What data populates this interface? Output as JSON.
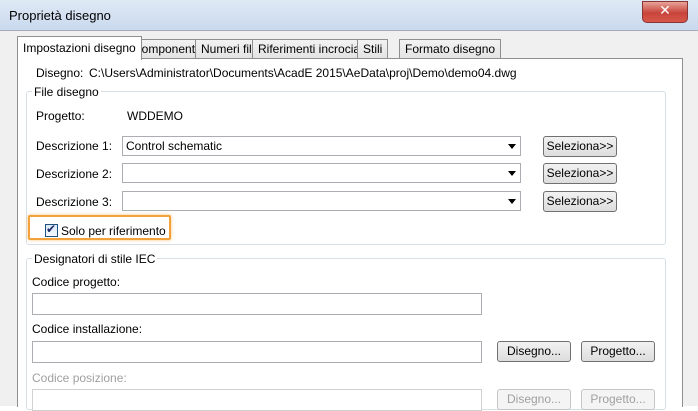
{
  "window": {
    "title": "Proprietà disegno",
    "close_glyph": "✕"
  },
  "tabs": [
    {
      "label": "Impostazioni disegno",
      "active": true
    },
    {
      "label": "Componenti"
    },
    {
      "label": "Numeri fili"
    },
    {
      "label": "Riferimenti incrociati"
    },
    {
      "label": "Stili"
    },
    {
      "label": "Formato disegno"
    }
  ],
  "drawing": {
    "label": "Disegno:",
    "path": "C:\\Users\\Administrator\\Documents\\AcadE 2015\\AeData\\proj\\Demo\\demo04.dwg"
  },
  "file_group": {
    "title": "File disegno",
    "project_label": "Progetto:",
    "project_value": "WDDEMO",
    "descriptions": [
      {
        "label": "Descrizione 1:",
        "value": "Control schematic",
        "button": "Seleziona>>"
      },
      {
        "label": "Descrizione 2:",
        "value": "",
        "button": "Seleziona>>"
      },
      {
        "label": "Descrizione 3:",
        "value": "",
        "button": "Seleziona>>"
      }
    ],
    "reference_only": {
      "label": "Solo per riferimento",
      "checked": true,
      "check_glyph": "✔"
    }
  },
  "iec_group": {
    "title": "Designatori di stile IEC",
    "project_code_label": "Codice progetto:",
    "project_code_value": "",
    "installation_label": "Codice installazione:",
    "installation_value": "",
    "location_label": "Codice posizione:",
    "location_value": "",
    "drawing_button": "Disegno...",
    "project_button": "Progetto...",
    "drawing_button_2": "Disegno...",
    "project_button_2": "Progetto..."
  },
  "colors": {
    "highlight": "#f3a23b",
    "close": "#c7443a"
  }
}
